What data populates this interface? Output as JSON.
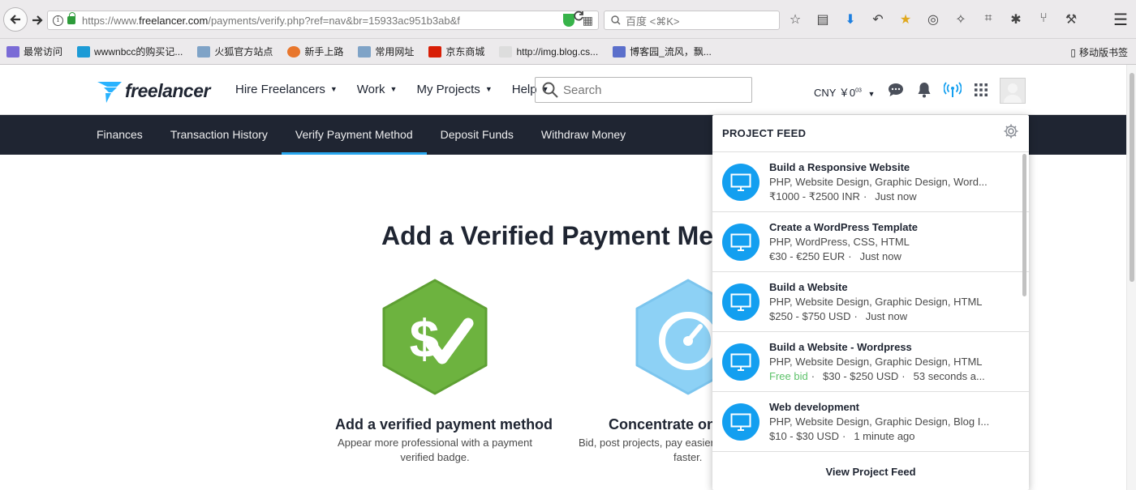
{
  "browser": {
    "url_prefix": "https://www.",
    "url_host": "freelancer.com",
    "url_path": "/payments/verify.php?ref=nav&br=15933ac951b3ab&f",
    "search_placeholder": "百度 <⌘K>",
    "bookmarks": [
      {
        "label": "最常访问",
        "color": "#7a6bd6"
      },
      {
        "label": "wwwnbcc的购买记...",
        "color": "#1d9bd6"
      },
      {
        "label": "火狐官方站点",
        "color": "#7fa3c7"
      },
      {
        "label": "新手上路",
        "color": "#e8762c"
      },
      {
        "label": "常用网址",
        "color": "#7fa3c7"
      },
      {
        "label": "京东商城",
        "color": "#d81e06"
      },
      {
        "label": "http://img.blog.cs...",
        "color": "#dddddd"
      },
      {
        "label": "博客园_流风，飘...",
        "color": "#5b6fcb"
      }
    ],
    "mobile_bookmarks": "移动版书签"
  },
  "header": {
    "logo_text": "freelancer",
    "nav": [
      "Hire Freelancers",
      "Work",
      "My Projects",
      "Help"
    ],
    "search_placeholder": "Search",
    "currency": "CNY ￥0",
    "currency_cents": "03"
  },
  "subnav": {
    "items": [
      "Finances",
      "Transaction History",
      "Verify Payment Method",
      "Deposit Funds",
      "Withdraw Money"
    ],
    "active_index": 2
  },
  "main": {
    "title": "Add a Verified Payment Meth",
    "features": [
      {
        "title": "Add a verified payment method",
        "desc_line1": "Appear more professional with a payment",
        "desc_line2": "verified badge."
      },
      {
        "title": "Concentrate on s",
        "desc_line1": "Bid, post projects, pay easier",
        "desc_line2": "faster."
      }
    ]
  },
  "feed": {
    "title": "PROJECT FEED",
    "items": [
      {
        "name": "Build a Responsive Website",
        "skills": "PHP, Website Design, Graphic Design, Word...",
        "budget": "₹1000 - ₹2500 INR",
        "time": "Just now",
        "free": ""
      },
      {
        "name": "Create a WordPress Template",
        "skills": "PHP, WordPress, CSS, HTML",
        "budget": "€30 - €250 EUR",
        "time": "Just now",
        "free": ""
      },
      {
        "name": "Build a Website",
        "skills": "PHP, Website Design, Graphic Design, HTML",
        "budget": "$250 - $750 USD",
        "time": "Just now",
        "free": ""
      },
      {
        "name": "Build a Website - Wordpress",
        "skills": "PHP, Website Design, Graphic Design, HTML",
        "budget": "$30 - $250 USD",
        "time": "53 seconds a...",
        "free": "Free bid"
      },
      {
        "name": "Web development",
        "skills": "PHP, Website Design, Graphic Design, Blog I...",
        "budget": "$10 - $30 USD",
        "time": "1 minute ago",
        "free": ""
      }
    ],
    "footer": "View Project Feed"
  },
  "colors": {
    "dark_nav": "#1f2532",
    "accent_blue": "#29b2fe",
    "feed_icon_blue": "#139ff0",
    "green_badge": "#6db33f",
    "free_bid_green": "#5dc26a"
  }
}
